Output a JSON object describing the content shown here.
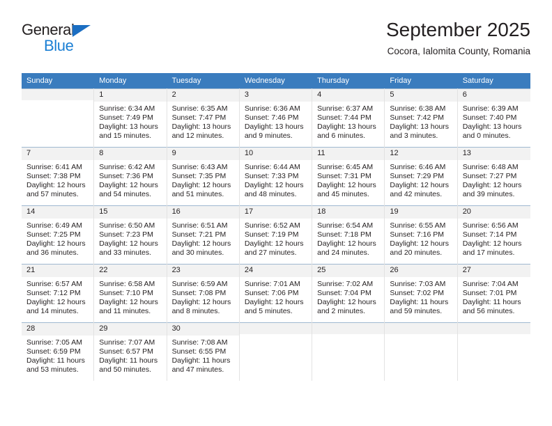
{
  "brand": {
    "name_dark": "General",
    "name_blue": "Blue",
    "accent_blue": "#1b7fd4",
    "triangle_blue": "#1b6ec2"
  },
  "header": {
    "title": "September 2025",
    "subtitle": "Cocora, Ialomita County, Romania"
  },
  "calendar": {
    "header_bg": "#3a7cbe",
    "daynum_bg": "#f2f2f2",
    "weekday_headers": [
      "Sunday",
      "Monday",
      "Tuesday",
      "Wednesday",
      "Thursday",
      "Friday",
      "Saturday"
    ],
    "weeks": [
      [
        {
          "day": "",
          "sunrise": "",
          "sunset": "",
          "daylight_line1": "",
          "daylight_line2": ""
        },
        {
          "day": "1",
          "sunrise": "Sunrise: 6:34 AM",
          "sunset": "Sunset: 7:49 PM",
          "daylight_line1": "Daylight: 13 hours",
          "daylight_line2": "and 15 minutes."
        },
        {
          "day": "2",
          "sunrise": "Sunrise: 6:35 AM",
          "sunset": "Sunset: 7:47 PM",
          "daylight_line1": "Daylight: 13 hours",
          "daylight_line2": "and 12 minutes."
        },
        {
          "day": "3",
          "sunrise": "Sunrise: 6:36 AM",
          "sunset": "Sunset: 7:46 PM",
          "daylight_line1": "Daylight: 13 hours",
          "daylight_line2": "and 9 minutes."
        },
        {
          "day": "4",
          "sunrise": "Sunrise: 6:37 AM",
          "sunset": "Sunset: 7:44 PM",
          "daylight_line1": "Daylight: 13 hours",
          "daylight_line2": "and 6 minutes."
        },
        {
          "day": "5",
          "sunrise": "Sunrise: 6:38 AM",
          "sunset": "Sunset: 7:42 PM",
          "daylight_line1": "Daylight: 13 hours",
          "daylight_line2": "and 3 minutes."
        },
        {
          "day": "6",
          "sunrise": "Sunrise: 6:39 AM",
          "sunset": "Sunset: 7:40 PM",
          "daylight_line1": "Daylight: 13 hours",
          "daylight_line2": "and 0 minutes."
        }
      ],
      [
        {
          "day": "7",
          "sunrise": "Sunrise: 6:41 AM",
          "sunset": "Sunset: 7:38 PM",
          "daylight_line1": "Daylight: 12 hours",
          "daylight_line2": "and 57 minutes."
        },
        {
          "day": "8",
          "sunrise": "Sunrise: 6:42 AM",
          "sunset": "Sunset: 7:36 PM",
          "daylight_line1": "Daylight: 12 hours",
          "daylight_line2": "and 54 minutes."
        },
        {
          "day": "9",
          "sunrise": "Sunrise: 6:43 AM",
          "sunset": "Sunset: 7:35 PM",
          "daylight_line1": "Daylight: 12 hours",
          "daylight_line2": "and 51 minutes."
        },
        {
          "day": "10",
          "sunrise": "Sunrise: 6:44 AM",
          "sunset": "Sunset: 7:33 PM",
          "daylight_line1": "Daylight: 12 hours",
          "daylight_line2": "and 48 minutes."
        },
        {
          "day": "11",
          "sunrise": "Sunrise: 6:45 AM",
          "sunset": "Sunset: 7:31 PM",
          "daylight_line1": "Daylight: 12 hours",
          "daylight_line2": "and 45 minutes."
        },
        {
          "day": "12",
          "sunrise": "Sunrise: 6:46 AM",
          "sunset": "Sunset: 7:29 PM",
          "daylight_line1": "Daylight: 12 hours",
          "daylight_line2": "and 42 minutes."
        },
        {
          "day": "13",
          "sunrise": "Sunrise: 6:48 AM",
          "sunset": "Sunset: 7:27 PM",
          "daylight_line1": "Daylight: 12 hours",
          "daylight_line2": "and 39 minutes."
        }
      ],
      [
        {
          "day": "14",
          "sunrise": "Sunrise: 6:49 AM",
          "sunset": "Sunset: 7:25 PM",
          "daylight_line1": "Daylight: 12 hours",
          "daylight_line2": "and 36 minutes."
        },
        {
          "day": "15",
          "sunrise": "Sunrise: 6:50 AM",
          "sunset": "Sunset: 7:23 PM",
          "daylight_line1": "Daylight: 12 hours",
          "daylight_line2": "and 33 minutes."
        },
        {
          "day": "16",
          "sunrise": "Sunrise: 6:51 AM",
          "sunset": "Sunset: 7:21 PM",
          "daylight_line1": "Daylight: 12 hours",
          "daylight_line2": "and 30 minutes."
        },
        {
          "day": "17",
          "sunrise": "Sunrise: 6:52 AM",
          "sunset": "Sunset: 7:19 PM",
          "daylight_line1": "Daylight: 12 hours",
          "daylight_line2": "and 27 minutes."
        },
        {
          "day": "18",
          "sunrise": "Sunrise: 6:54 AM",
          "sunset": "Sunset: 7:18 PM",
          "daylight_line1": "Daylight: 12 hours",
          "daylight_line2": "and 24 minutes."
        },
        {
          "day": "19",
          "sunrise": "Sunrise: 6:55 AM",
          "sunset": "Sunset: 7:16 PM",
          "daylight_line1": "Daylight: 12 hours",
          "daylight_line2": "and 20 minutes."
        },
        {
          "day": "20",
          "sunrise": "Sunrise: 6:56 AM",
          "sunset": "Sunset: 7:14 PM",
          "daylight_line1": "Daylight: 12 hours",
          "daylight_line2": "and 17 minutes."
        }
      ],
      [
        {
          "day": "21",
          "sunrise": "Sunrise: 6:57 AM",
          "sunset": "Sunset: 7:12 PM",
          "daylight_line1": "Daylight: 12 hours",
          "daylight_line2": "and 14 minutes."
        },
        {
          "day": "22",
          "sunrise": "Sunrise: 6:58 AM",
          "sunset": "Sunset: 7:10 PM",
          "daylight_line1": "Daylight: 12 hours",
          "daylight_line2": "and 11 minutes."
        },
        {
          "day": "23",
          "sunrise": "Sunrise: 6:59 AM",
          "sunset": "Sunset: 7:08 PM",
          "daylight_line1": "Daylight: 12 hours",
          "daylight_line2": "and 8 minutes."
        },
        {
          "day": "24",
          "sunrise": "Sunrise: 7:01 AM",
          "sunset": "Sunset: 7:06 PM",
          "daylight_line1": "Daylight: 12 hours",
          "daylight_line2": "and 5 minutes."
        },
        {
          "day": "25",
          "sunrise": "Sunrise: 7:02 AM",
          "sunset": "Sunset: 7:04 PM",
          "daylight_line1": "Daylight: 12 hours",
          "daylight_line2": "and 2 minutes."
        },
        {
          "day": "26",
          "sunrise": "Sunrise: 7:03 AM",
          "sunset": "Sunset: 7:02 PM",
          "daylight_line1": "Daylight: 11 hours",
          "daylight_line2": "and 59 minutes."
        },
        {
          "day": "27",
          "sunrise": "Sunrise: 7:04 AM",
          "sunset": "Sunset: 7:01 PM",
          "daylight_line1": "Daylight: 11 hours",
          "daylight_line2": "and 56 minutes."
        }
      ],
      [
        {
          "day": "28",
          "sunrise": "Sunrise: 7:05 AM",
          "sunset": "Sunset: 6:59 PM",
          "daylight_line1": "Daylight: 11 hours",
          "daylight_line2": "and 53 minutes."
        },
        {
          "day": "29",
          "sunrise": "Sunrise: 7:07 AM",
          "sunset": "Sunset: 6:57 PM",
          "daylight_line1": "Daylight: 11 hours",
          "daylight_line2": "and 50 minutes."
        },
        {
          "day": "30",
          "sunrise": "Sunrise: 7:08 AM",
          "sunset": "Sunset: 6:55 PM",
          "daylight_line1": "Daylight: 11 hours",
          "daylight_line2": "and 47 minutes."
        },
        {
          "day": "",
          "sunrise": "",
          "sunset": "",
          "daylight_line1": "",
          "daylight_line2": ""
        },
        {
          "day": "",
          "sunrise": "",
          "sunset": "",
          "daylight_line1": "",
          "daylight_line2": ""
        },
        {
          "day": "",
          "sunrise": "",
          "sunset": "",
          "daylight_line1": "",
          "daylight_line2": ""
        },
        {
          "day": "",
          "sunrise": "",
          "sunset": "",
          "daylight_line1": "",
          "daylight_line2": ""
        }
      ]
    ]
  }
}
